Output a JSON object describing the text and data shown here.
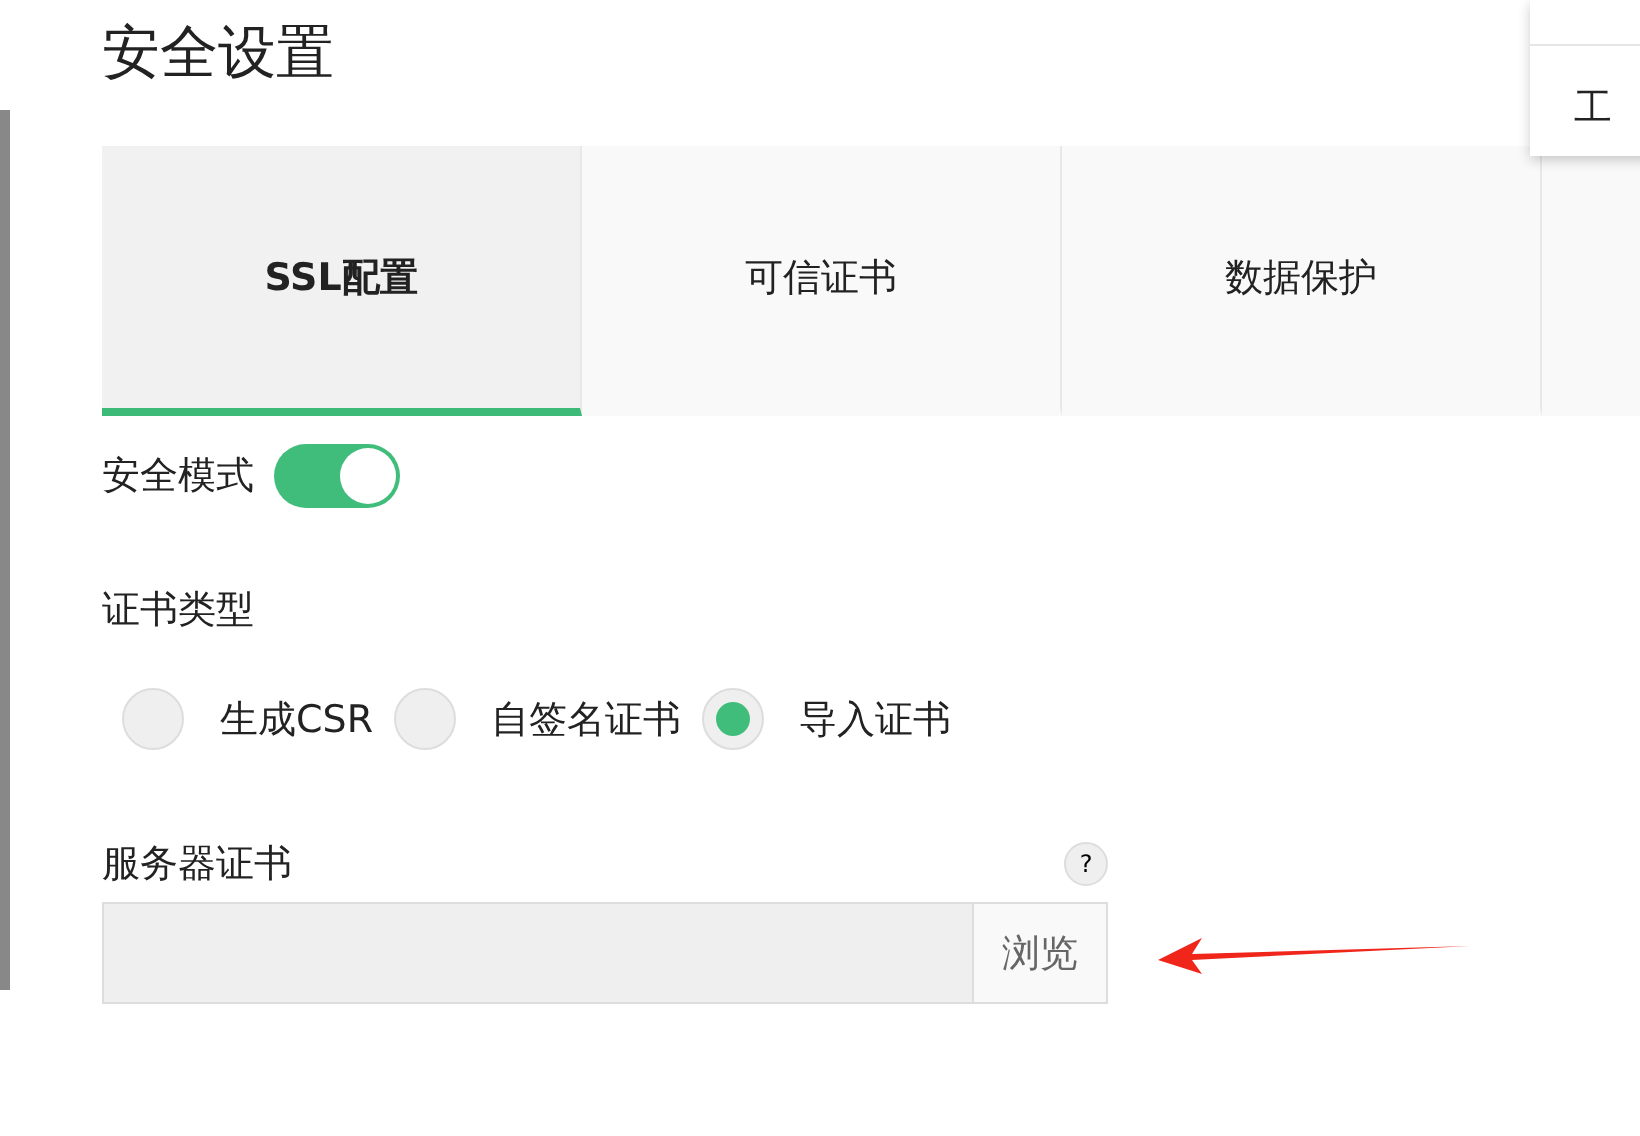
{
  "title": "安全设置",
  "tabs": [
    {
      "label": "SSL配置",
      "selected": true
    },
    {
      "label": "可信证书",
      "selected": false
    },
    {
      "label": "数据保护",
      "selected": false
    },
    {
      "selected": false
    }
  ],
  "secure_mode": {
    "label": "安全模式",
    "on": true
  },
  "cert_type": {
    "label": "证书类型",
    "options": [
      {
        "label": "生成CSR",
        "selected": false
      },
      {
        "label": "自签名证书",
        "selected": false
      },
      {
        "label": "导入证书",
        "selected": true
      }
    ]
  },
  "server_cert": {
    "label": "服务器证书",
    "help": "?",
    "browse": "浏览"
  },
  "menu": {
    "items": [
      "工"
    ]
  }
}
